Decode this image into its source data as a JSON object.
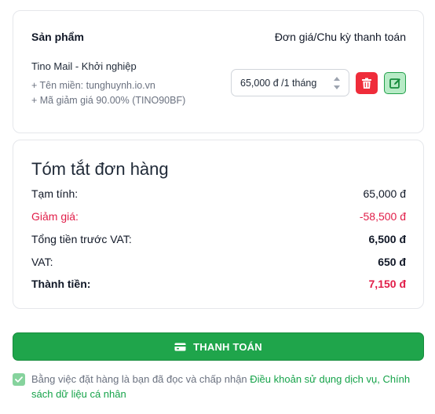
{
  "product_table": {
    "header_product": "Sản phẩm",
    "header_price": "Đơn giá/Chu kỳ thanh toán",
    "item": {
      "name": "Tino Mail - Khởi nghiệp",
      "domain_line": "+ Tên miền: tunghuynh.io.vn",
      "coupon_line": "+ Mã giảm giá 90.00% (TINO90BF)",
      "billing_cycle": "65,000 đ /1 tháng"
    },
    "delete_icon": "trash-icon",
    "edit_icon": "edit-icon"
  },
  "summary": {
    "title": "Tóm tắt đơn hàng",
    "subtotal_label": "Tạm tính:",
    "subtotal_value": "65,000 đ",
    "discount_label": "Giảm giá:",
    "discount_value": "-58,500 đ",
    "before_vat_label": "Tổng tiền trước VAT:",
    "before_vat_value": "6,500 đ",
    "vat_label": "VAT:",
    "vat_value": "650 đ",
    "total_label": "Thành tiền:",
    "total_value": "7,150 đ"
  },
  "checkout": {
    "label": "THANH TOÁN",
    "icon": "payment-card-icon"
  },
  "terms": {
    "checked": true,
    "text": "Bằng việc đặt hàng là bạn đã đọc và chấp nhận ",
    "link_terms": "Điều khoản sử dụng dịch vụ",
    "separator": ", ",
    "link_privacy": "Chính sách dữ liệu cá nhân"
  },
  "colors": {
    "accent_green": "#1fa54b",
    "danger_red": "#ef2c3a",
    "discount_pink": "#e11d48"
  }
}
